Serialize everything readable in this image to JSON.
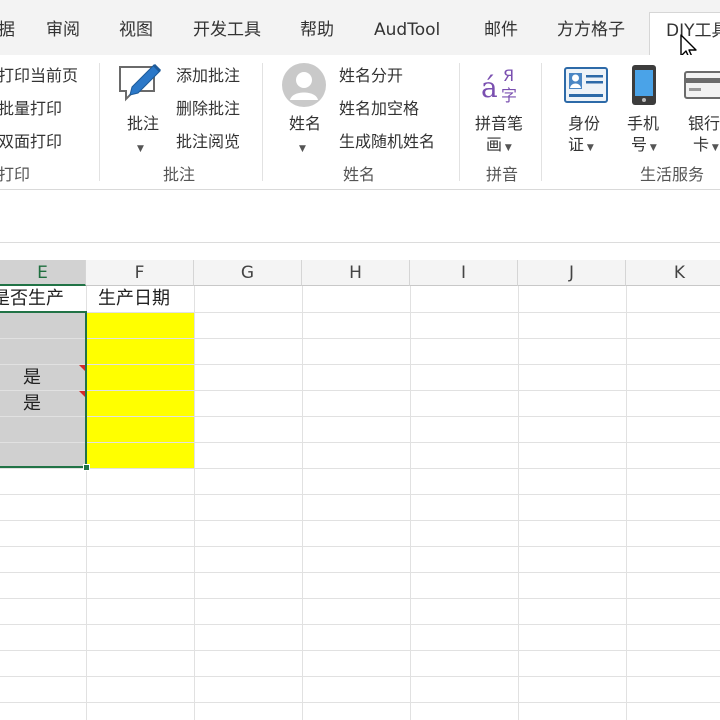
{
  "ribbon_tabs": [
    {
      "label": "据"
    },
    {
      "label": "审阅"
    },
    {
      "label": "视图"
    },
    {
      "label": "开发工具"
    },
    {
      "label": "帮助"
    },
    {
      "label": "AudTool"
    },
    {
      "label": "邮件"
    },
    {
      "label": "方方格子"
    },
    {
      "label": "DIY工具",
      "active": true
    }
  ],
  "ribbon": {
    "print_group": {
      "items": [
        "打印当前页",
        "批量打印",
        "双面打印"
      ],
      "label": "打印"
    },
    "comment_group": {
      "big_button": "批注",
      "items": [
        "添加批注",
        "删除批注",
        "批注阅览"
      ],
      "label": "批注"
    },
    "name_group": {
      "big_button": "姓名",
      "items": [
        "姓名分开",
        "姓名加空格",
        "生成随机姓名"
      ],
      "label": "姓名"
    },
    "pinyin_group": {
      "big_button_line1": "拼音笔",
      "big_button_line2": "画",
      "label": "拼音"
    },
    "life_group": {
      "id_button_line1": "身份",
      "id_button_line2": "证",
      "phone_button_line1": "手机",
      "phone_button_line2": "号",
      "bank_button_line1": "银行",
      "bank_button_line2": "卡",
      "label": "生活服务"
    }
  },
  "sheet": {
    "columns": [
      "E",
      "F",
      "G",
      "H",
      "I",
      "J",
      "K"
    ],
    "selected_column": "E",
    "header_row": {
      "E": "是否生产",
      "F": "生产日期"
    },
    "cells": {
      "E_row3": "是",
      "E_row4": "是"
    },
    "colors": {
      "selection": "#217346",
      "yellow_fill": "#ffff00",
      "grey_fill": "#d0d0d0",
      "comment_marker": "#d42a2a"
    }
  },
  "icons": [
    "comment-icon",
    "person-icon",
    "pinyin-icon",
    "id-card-icon",
    "phone-icon",
    "bank-card-icon",
    "mouse-cursor-icon"
  ]
}
